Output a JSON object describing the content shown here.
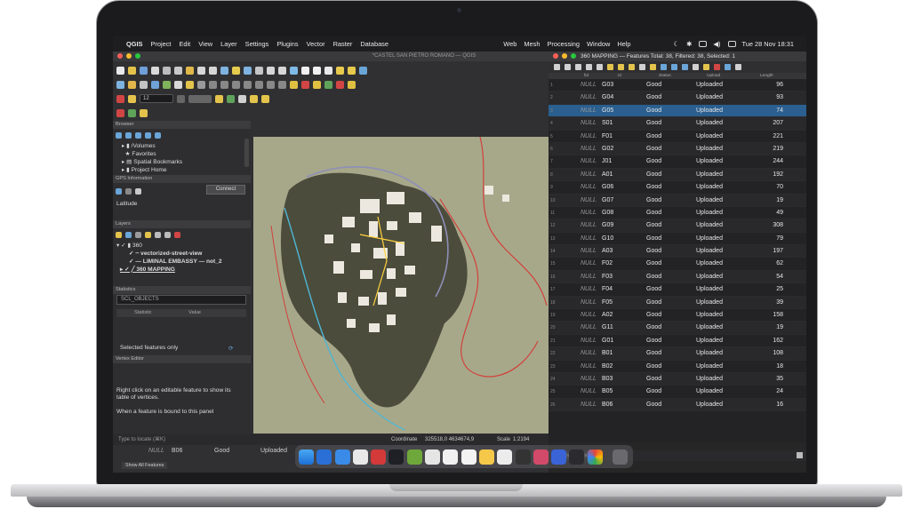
{
  "menubar": {
    "app": "QGIS",
    "items": [
      "Project",
      "Edit",
      "View",
      "Layer",
      "Settings",
      "Plugins",
      "Vector",
      "Raster",
      "Database"
    ],
    "right_items": [
      "Web",
      "Mesh",
      "Processing",
      "Window",
      "Help"
    ],
    "clock": "Tue 28 Nov  18:31"
  },
  "qgis": {
    "window_title": "*CASTEL SAN PIETRO ROMANO — QGIS",
    "scale_field": "12",
    "browser": {
      "section": "Browser",
      "items": [
        "/Volumes",
        "Favorites",
        "Spatial Bookmarks",
        "Project Home"
      ]
    },
    "gps": {
      "section": "GPS Information",
      "connect": "Connect",
      "latitude_label": "Latitude"
    },
    "layers": {
      "section": "Layers",
      "group": "360",
      "items": [
        "vectorized-street-view",
        "LIMINAL EMBASSY  — not_2",
        "360 MAPPING"
      ]
    },
    "statistics": {
      "section": "Statistics",
      "layer": "SCL_OBJECTS",
      "col1": "Statistic",
      "col2": "Value",
      "selected_only": "Selected features only"
    },
    "vertex_editor": {
      "section": "Vertex Editor",
      "hint": "Right click on an editable feature to show its table of vertices.",
      "hint2": "When a feature is bound to this panel"
    },
    "status": {
      "locate_placeholder": "Type to locate (⌘K)",
      "coordinate_label": "Coordinate",
      "coordinate": "325518,0  4634674,9",
      "scale_label": "Scale",
      "scale": "1:2194"
    }
  },
  "attribute_table": {
    "title": "360 MAPPING — Features Total: 38, Filtered: 38, Selected: 1",
    "headers": [
      "fid",
      "id",
      "Status",
      "Upload",
      "Length"
    ],
    "rows": [
      {
        "n": "1",
        "null": "NULL",
        "id": "G03",
        "status": "Good",
        "upload": "Uploaded",
        "length": "96"
      },
      {
        "n": "2",
        "null": "NULL",
        "id": "G04",
        "status": "Good",
        "upload": "Uploaded",
        "length": "93"
      },
      {
        "n": "3",
        "null": "NULL",
        "id": "G05",
        "status": "Good",
        "upload": "Uploaded",
        "length": "74"
      },
      {
        "n": "4",
        "null": "NULL",
        "id": "S01",
        "status": "Good",
        "upload": "Uploaded",
        "length": "207"
      },
      {
        "n": "5",
        "null": "NULL",
        "id": "F01",
        "status": "Good",
        "upload": "Uploaded",
        "length": "221"
      },
      {
        "n": "6",
        "null": "NULL",
        "id": "G02",
        "status": "Good",
        "upload": "Uploaded",
        "length": "219"
      },
      {
        "n": "7",
        "null": "NULL",
        "id": "J01",
        "status": "Good",
        "upload": "Uploaded",
        "length": "244"
      },
      {
        "n": "8",
        "null": "NULL",
        "id": "A01",
        "status": "Good",
        "upload": "Uploaded",
        "length": "192"
      },
      {
        "n": "9",
        "null": "NULL",
        "id": "G06",
        "status": "Good",
        "upload": "Uploaded",
        "length": "70"
      },
      {
        "n": "10",
        "null": "NULL",
        "id": "G07",
        "status": "Good",
        "upload": "Uploaded",
        "length": "19"
      },
      {
        "n": "11",
        "null": "NULL",
        "id": "G08",
        "status": "Good",
        "upload": "Uploaded",
        "length": "49"
      },
      {
        "n": "12",
        "null": "NULL",
        "id": "G09",
        "status": "Good",
        "upload": "Uploaded",
        "length": "308"
      },
      {
        "n": "13",
        "null": "NULL",
        "id": "G10",
        "status": "Good",
        "upload": "Uploaded",
        "length": "79"
      },
      {
        "n": "14",
        "null": "NULL",
        "id": "A03",
        "status": "Good",
        "upload": "Uploaded",
        "length": "197"
      },
      {
        "n": "15",
        "null": "NULL",
        "id": "F02",
        "status": "Good",
        "upload": "Uploaded",
        "length": "62"
      },
      {
        "n": "16",
        "null": "NULL",
        "id": "F03",
        "status": "Good",
        "upload": "Uploaded",
        "length": "54"
      },
      {
        "n": "17",
        "null": "NULL",
        "id": "F04",
        "status": "Good",
        "upload": "Uploaded",
        "length": "25"
      },
      {
        "n": "18",
        "null": "NULL",
        "id": "F05",
        "status": "Good",
        "upload": "Uploaded",
        "length": "39"
      },
      {
        "n": "19",
        "null": "NULL",
        "id": "A02",
        "status": "Good",
        "upload": "Uploaded",
        "length": "158"
      },
      {
        "n": "20",
        "null": "NULL",
        "id": "G11",
        "status": "Good",
        "upload": "Uploaded",
        "length": "19"
      },
      {
        "n": "21",
        "null": "NULL",
        "id": "G01",
        "status": "Good",
        "upload": "Uploaded",
        "length": "162"
      },
      {
        "n": "22",
        "null": "NULL",
        "id": "B01",
        "status": "Good",
        "upload": "Uploaded",
        "length": "108"
      },
      {
        "n": "23",
        "null": "NULL",
        "id": "B02",
        "status": "Good",
        "upload": "Uploaded",
        "length": "18"
      },
      {
        "n": "24",
        "null": "NULL",
        "id": "B03",
        "status": "Good",
        "upload": "Uploaded",
        "length": "35"
      },
      {
        "n": "25",
        "null": "NULL",
        "id": "B05",
        "status": "Good",
        "upload": "Uploaded",
        "length": "24"
      },
      {
        "n": "26",
        "null": "NULL",
        "id": "B06",
        "status": "Good",
        "upload": "Uploaded",
        "length": "16"
      }
    ],
    "selected_index": 2,
    "footer_button": "Show All Features",
    "bottom_row": {
      "null": "NULL",
      "id": "B06",
      "status": "Good",
      "upload": "Uploaded"
    }
  },
  "colors": {
    "map_background": "#a7a88a",
    "terrain": "#4b4c3c",
    "selection": "#2a5f8f",
    "route_red": "#d2403a",
    "route_cyan": "#4fb6d6"
  }
}
